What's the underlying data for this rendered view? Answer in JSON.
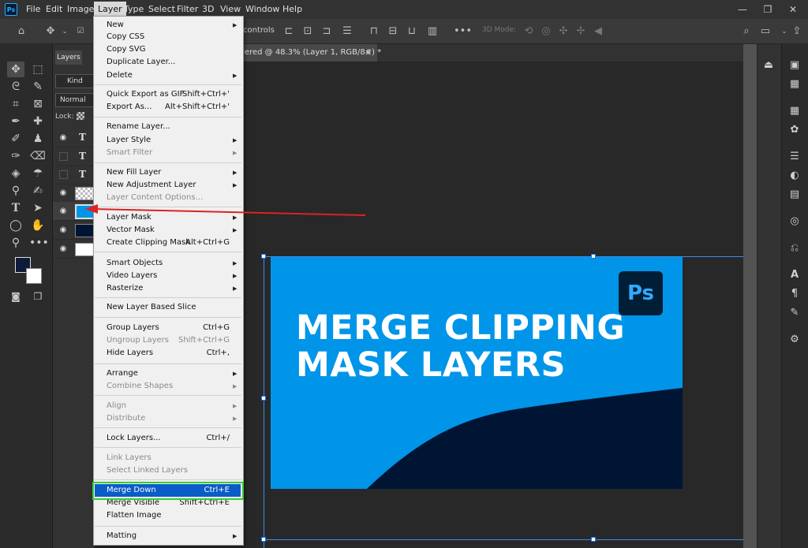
{
  "app": {
    "logo": "Ps"
  },
  "menubar": {
    "items": [
      "File",
      "Edit",
      "Image",
      "Layer",
      "Type",
      "Select",
      "Filter",
      "3D",
      "View",
      "Window",
      "Help"
    ]
  },
  "window": {
    "minimize": "—",
    "restore": "❐",
    "close": "✕"
  },
  "optbar": {
    "controls_text": "controls",
    "mode3d": "3D Mode:"
  },
  "document": {
    "tab_title": "vered @ 48.3% (Layer 1, RGB/8#) *",
    "close": "×"
  },
  "layers_panel": {
    "tab": "Layers",
    "kind": "Kind",
    "blend": "Normal",
    "lock": "Lock:",
    "type_glyph": "T"
  },
  "artwork": {
    "line1": "MERGE CLIPPING",
    "line2": "MASK LAYERS",
    "logo": "Ps",
    "colors": {
      "bg": "#0095e8",
      "wave": "#001534",
      "text": "#ffffff"
    }
  },
  "layer_menu": {
    "items": [
      {
        "label": "New",
        "shortcut": "",
        "submenu": true,
        "disabled": false
      },
      {
        "label": "Copy CSS",
        "shortcut": "",
        "submenu": false,
        "disabled": false
      },
      {
        "label": "Copy SVG",
        "shortcut": "",
        "submenu": false,
        "disabled": false
      },
      {
        "label": "Duplicate Layer...",
        "shortcut": "",
        "submenu": false,
        "disabled": false
      },
      {
        "label": "Delete",
        "shortcut": "",
        "submenu": true,
        "disabled": false
      },
      {
        "label": "Quick Export as GIF",
        "shortcut": "Shift+Ctrl+'",
        "submenu": false,
        "disabled": false
      },
      {
        "label": "Export As...",
        "shortcut": "Alt+Shift+Ctrl+'",
        "submenu": false,
        "disabled": false
      },
      {
        "label": "Rename Layer...",
        "shortcut": "",
        "submenu": false,
        "disabled": false
      },
      {
        "label": "Layer Style",
        "shortcut": "",
        "submenu": true,
        "disabled": false
      },
      {
        "label": "Smart Filter",
        "shortcut": "",
        "submenu": true,
        "disabled": true
      },
      {
        "label": "New Fill Layer",
        "shortcut": "",
        "submenu": true,
        "disabled": false
      },
      {
        "label": "New Adjustment Layer",
        "shortcut": "",
        "submenu": true,
        "disabled": false
      },
      {
        "label": "Layer Content Options...",
        "shortcut": "",
        "submenu": false,
        "disabled": true
      },
      {
        "label": "Layer Mask",
        "shortcut": "",
        "submenu": true,
        "disabled": false
      },
      {
        "label": "Vector Mask",
        "shortcut": "",
        "submenu": true,
        "disabled": false
      },
      {
        "label": "Create Clipping Mask",
        "shortcut": "Alt+Ctrl+G",
        "submenu": false,
        "disabled": false
      },
      {
        "label": "Smart Objects",
        "shortcut": "",
        "submenu": true,
        "disabled": false
      },
      {
        "label": "Video Layers",
        "shortcut": "",
        "submenu": true,
        "disabled": false
      },
      {
        "label": "Rasterize",
        "shortcut": "",
        "submenu": true,
        "disabled": false
      },
      {
        "label": "New Layer Based Slice",
        "shortcut": "",
        "submenu": false,
        "disabled": false
      },
      {
        "label": "Group Layers",
        "shortcut": "Ctrl+G",
        "submenu": false,
        "disabled": false
      },
      {
        "label": "Ungroup Layers",
        "shortcut": "Shift+Ctrl+G",
        "submenu": false,
        "disabled": true
      },
      {
        "label": "Hide Layers",
        "shortcut": "Ctrl+,",
        "submenu": false,
        "disabled": false
      },
      {
        "label": "Arrange",
        "shortcut": "",
        "submenu": true,
        "disabled": false
      },
      {
        "label": "Combine Shapes",
        "shortcut": "",
        "submenu": true,
        "disabled": true
      },
      {
        "label": "Align",
        "shortcut": "",
        "submenu": true,
        "disabled": true
      },
      {
        "label": "Distribute",
        "shortcut": "",
        "submenu": true,
        "disabled": true
      },
      {
        "label": "Lock Layers...",
        "shortcut": "Ctrl+/",
        "submenu": false,
        "disabled": false
      },
      {
        "label": "Link Layers",
        "shortcut": "",
        "submenu": false,
        "disabled": true
      },
      {
        "label": "Select Linked Layers",
        "shortcut": "",
        "submenu": false,
        "disabled": true
      },
      {
        "label": "Merge Down",
        "shortcut": "Ctrl+E",
        "submenu": false,
        "disabled": false,
        "highlighted": true
      },
      {
        "label": "Merge Visible",
        "shortcut": "Shift+Ctrl+E",
        "submenu": false,
        "disabled": false
      },
      {
        "label": "Flatten Image",
        "shortcut": "",
        "submenu": false,
        "disabled": false
      },
      {
        "label": "Matting",
        "shortcut": "",
        "submenu": true,
        "disabled": false
      }
    ]
  },
  "colors": {
    "accent": "#0a5cc7",
    "highlight_box": "#33cc33",
    "annotation_arrow": "#dd2222"
  }
}
